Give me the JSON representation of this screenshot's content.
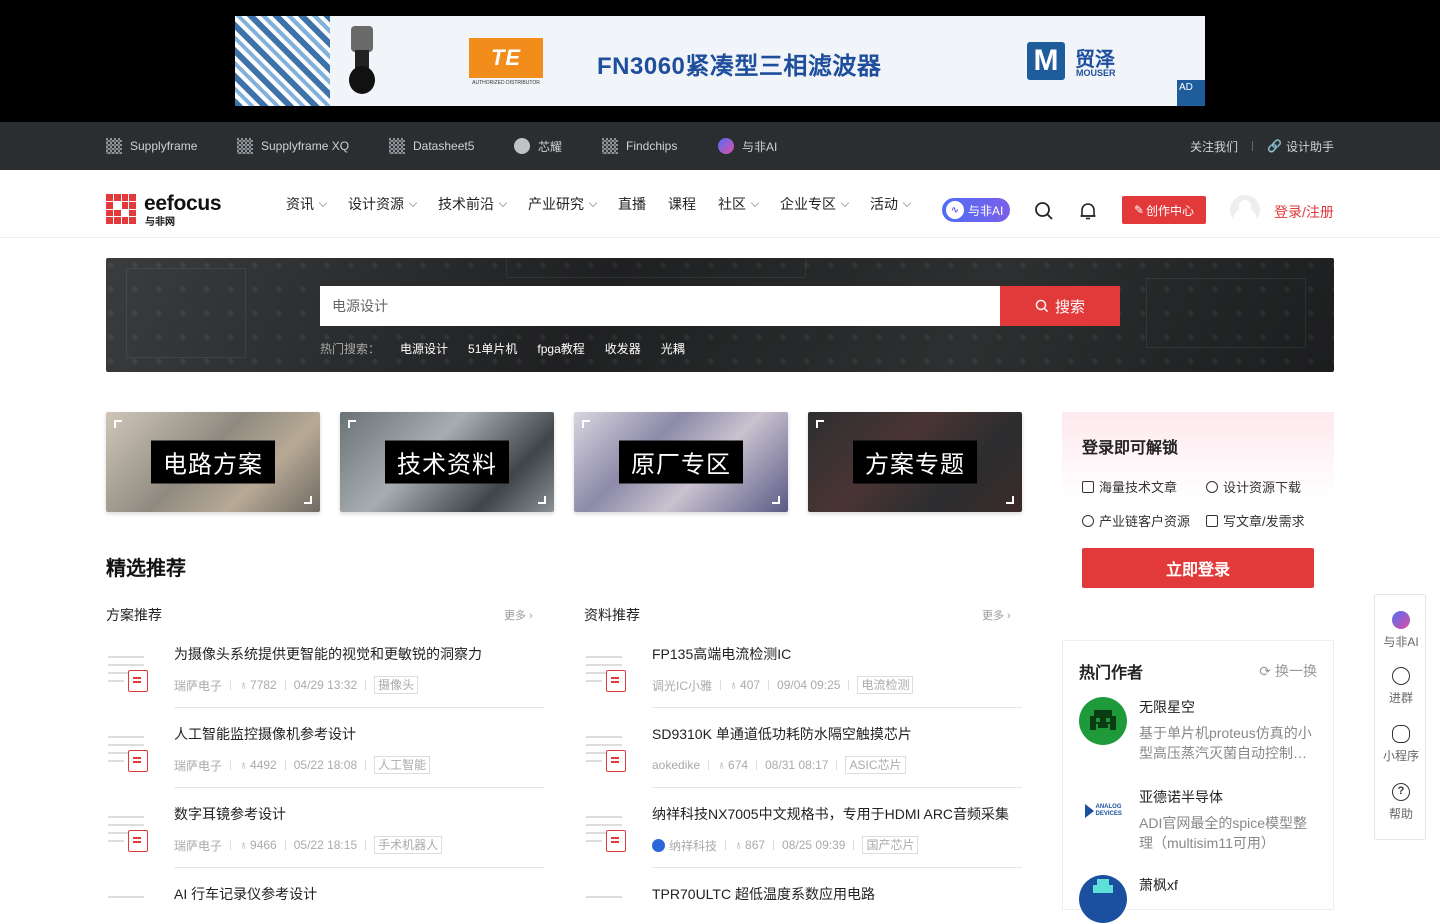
{
  "ad": {
    "te_logo": "TE",
    "te_sub": "AUTHORIZED DISTRIBUTOR",
    "title": "FN3060紧凑型三相滤波器",
    "mouser_cn": "贸泽",
    "mouser_en": "MOUSER",
    "badge": "AD"
  },
  "topnav": {
    "items": [
      "Supplyframe",
      "Supplyframe XQ",
      "Datasheet5",
      "芯耀",
      "Findchips",
      "与非AI"
    ],
    "follow": "关注我们",
    "assistant": "设计助手"
  },
  "header": {
    "logo_text": "eefocus",
    "logo_sub": "与非网",
    "nav": [
      {
        "label": "资讯",
        "dropdown": true
      },
      {
        "label": "设计资源",
        "dropdown": true
      },
      {
        "label": "技术前沿",
        "dropdown": true
      },
      {
        "label": "产业研究",
        "dropdown": true
      },
      {
        "label": "直播",
        "dropdown": false
      },
      {
        "label": "课程",
        "dropdown": false
      },
      {
        "label": "社区",
        "dropdown": true
      },
      {
        "label": "企业专区",
        "dropdown": true
      },
      {
        "label": "活动",
        "dropdown": true
      }
    ],
    "ai_pill": "与非AI",
    "create_button": "创作中心",
    "login": "登录/注册"
  },
  "search": {
    "placeholder": "电源设计",
    "button": "搜索",
    "hot_label": "热门搜索：",
    "hot": [
      "电源设计",
      "51单片机",
      "fpga教程",
      "收发器",
      "光耦"
    ]
  },
  "tiles": [
    "电路方案",
    "技术资料",
    "原厂专区",
    "方案专题"
  ],
  "section": {
    "title": "精选推荐",
    "more": "更多",
    "left_head": "方案推荐",
    "right_head": "资料推荐",
    "left": [
      {
        "title": "为摄像头系统提供更智能的视觉和更敏锐的洞察力",
        "author": "瑞萨电子",
        "views": "7782",
        "date": "04/29 13:32",
        "tag": "摄像头"
      },
      {
        "title": "人工智能监控摄像机参考设计",
        "author": "瑞萨电子",
        "views": "4492",
        "date": "05/22 18:08",
        "tag": "人工智能"
      },
      {
        "title": "数字耳镜参考设计",
        "author": "瑞萨电子",
        "views": "9466",
        "date": "05/22 18:15",
        "tag": "手术机器人"
      },
      {
        "title": "AI 行车记录仪参考设计",
        "author": "",
        "views": "",
        "date": "",
        "tag": ""
      }
    ],
    "right": [
      {
        "title": "FP135高端电流检测IC",
        "author": "调光IC小雅",
        "views": "407",
        "date": "09/04 09:25",
        "tag": "电流检测"
      },
      {
        "title": "SD9310K 单通道低功耗防水隔空触摸芯片",
        "author": "aokedike",
        "views": "674",
        "date": "08/31 08:17",
        "tag": "ASIC芯片"
      },
      {
        "title": "纳祥科技NX7005中文规格书，专用于HDMI ARC音频采集",
        "author": "纳祥科技",
        "views": "867",
        "date": "08/25 09:39",
        "tag": "国产芯片"
      },
      {
        "title": "TPR70ULTC 超低温度系数应用电路",
        "author": "",
        "views": "",
        "date": "",
        "tag": ""
      }
    ]
  },
  "login_card": {
    "title": "登录即可解锁",
    "features": [
      "海量技术文章",
      "设计资源下载",
      "产业链客户资源",
      "写文章/发需求"
    ],
    "button": "立即登录"
  },
  "authors": {
    "title": "热门作者",
    "switch": "换一换",
    "list": [
      {
        "name": "无限星空",
        "desc": "基于单片机proteus仿真的小型高压蒸汽灭菌自动控制…",
        "color": "#1f9a3a"
      },
      {
        "name": "亚德诺半导体",
        "desc": "ADI官网最全的spice模型整理（multisim11可用）",
        "color": "#ffffff"
      },
      {
        "name": "萧枫xf",
        "desc": "",
        "color": "#1b4fa0"
      }
    ],
    "adi_logo": "ANALOG DEVICES"
  },
  "floatbar": [
    "与非AI",
    "进群",
    "小程序",
    "帮助"
  ]
}
